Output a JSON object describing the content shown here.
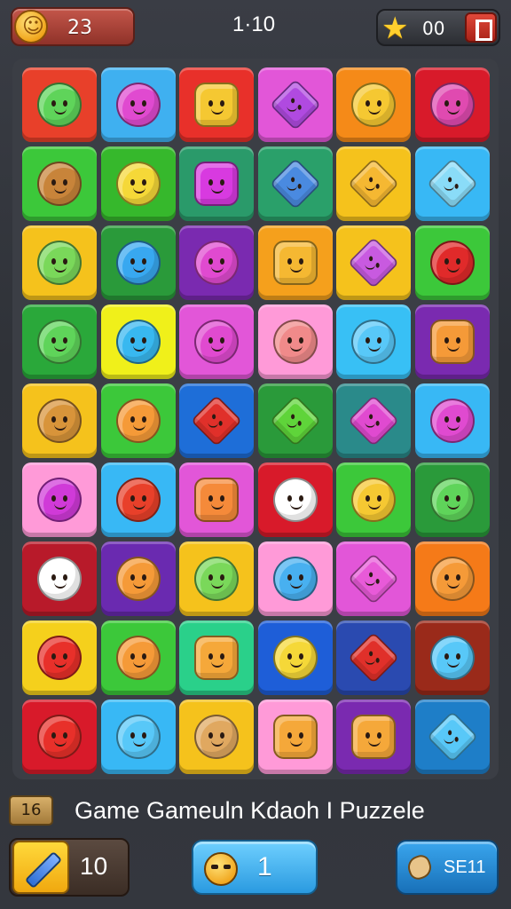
{
  "hud": {
    "coins": "23",
    "level": "1·10",
    "stars": "00"
  },
  "board": {
    "rows": 9,
    "cols": 6,
    "tiles": [
      [
        "#e8402a",
        "#3fb0f0",
        "#e8302a",
        "#e256d8",
        "#f58a18",
        "#d81a2a"
      ],
      [
        "#3cc83a",
        "#36b82c",
        "#2a9a6a",
        "#2aa06a",
        "#f5c21c",
        "#38b8f5"
      ],
      [
        "#f5c21c",
        "#2a9a3a",
        "#7a2ab0",
        "#f5a01c",
        "#f5c21c",
        "#3cc83a"
      ],
      [
        "#2aa83a",
        "#f0f01a",
        "#e256d8",
        "#ff9ad8",
        "#38c0f5",
        "#7a2ab0"
      ],
      [
        "#f5c21c",
        "#3cc83a",
        "#1e6ed8",
        "#2a9a3a",
        "#2a8a8a",
        "#38b8f5"
      ],
      [
        "#ff9ad8",
        "#38b8f5",
        "#e256d8",
        "#d81a2a",
        "#3cc83a",
        "#2a9a3a"
      ],
      [
        "#b81a2a",
        "#6a2ab0",
        "#f5c21c",
        "#ff9ad8",
        "#e256d8",
        "#f57a18"
      ],
      [
        "#f5d01c",
        "#3cc83a",
        "#2ad08a",
        "#1e5ed8",
        "#2a4ab0",
        "#9a2a1a"
      ],
      [
        "#d81a2a",
        "#38b8f5",
        "#f5c21c",
        "#ff9ad8",
        "#7a2ab0",
        "#1e7ec8"
      ]
    ],
    "pieces": [
      [
        "#5fd45a",
        "#e04ad0",
        "#f5c832",
        "#b04ae0",
        "#f5c832",
        "#e04ab0"
      ],
      [
        "#c8843a",
        "#f5d838",
        "#d83ae0",
        "#4a8ae0",
        "#f5b832",
        "#8adcf8"
      ],
      [
        "#7ad85a",
        "#38a8f0",
        "#e04ad0",
        "#f5b832",
        "#c85ae0",
        "#e02a2a"
      ],
      [
        "#5fd45a",
        "#38b8f0",
        "#e04ad0",
        "#f08a8a",
        "#58c8f8",
        "#f59a38"
      ],
      [
        "#d8943a",
        "#f59a38",
        "#e0302a",
        "#5fd43a",
        "#e04ad0",
        "#e04ad0"
      ],
      [
        "#d03ad8",
        "#e8402a",
        "#f58a3a",
        "#ffffff",
        "#f5c832",
        "#5fd45a"
      ],
      [
        "#ffffff",
        "#f59a38",
        "#7ad85a",
        "#48b0f0",
        "#e85ad8",
        "#f59a38"
      ],
      [
        "#e8302a",
        "#f59a38",
        "#f5a83a",
        "#f5d838",
        "#e0302a",
        "#58c8f8"
      ],
      [
        "#e8302a",
        "#58c8f8",
        "#e0a860",
        "#f5a83a",
        "#f5a83a",
        "#58c8f8"
      ]
    ],
    "shapes": [
      [
        "round",
        "round",
        "square",
        "diamond",
        "round",
        "round"
      ],
      [
        "round",
        "round",
        "square",
        "diamond",
        "diamond",
        "diamond"
      ],
      [
        "round",
        "round",
        "round",
        "square",
        "diamond",
        "round"
      ],
      [
        "round",
        "round",
        "round",
        "round",
        "round",
        "square"
      ],
      [
        "round",
        "round",
        "diamond",
        "diamond",
        "diamond",
        "round"
      ],
      [
        "round",
        "round",
        "square",
        "round",
        "round",
        "round"
      ],
      [
        "round",
        "round",
        "round",
        "round",
        "diamond",
        "round"
      ],
      [
        "round",
        "round",
        "square",
        "round",
        "diamond",
        "round"
      ],
      [
        "round",
        "round",
        "round",
        "square",
        "square",
        "diamond"
      ]
    ]
  },
  "footer": {
    "badge": "16",
    "title": "Game Gameuln Kdaoh I Puzzele"
  },
  "bottom": {
    "tool_count": "10",
    "hint_count": "1",
    "shuffle_label": "SE11"
  },
  "icons": {
    "coin": "coin-face-icon",
    "star": "star-icon",
    "exit": "exit-door-icon",
    "tool": "pencil-tool-icon",
    "hint": "hint-face-icon",
    "shuffle": "shuffle-icon"
  }
}
